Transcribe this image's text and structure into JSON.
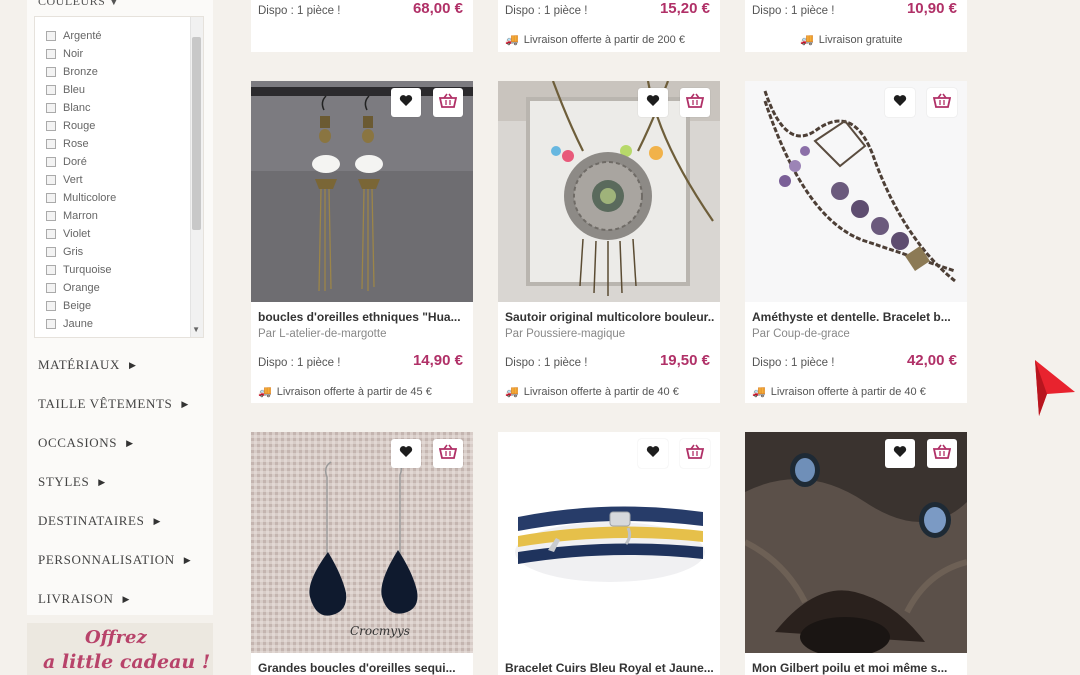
{
  "sidebar": {
    "colors_title": "COULEURS",
    "colors": [
      "Argenté",
      "Noir",
      "Bronze",
      "Bleu",
      "Blanc",
      "Rouge",
      "Rose",
      "Doré",
      "Vert",
      "Multicolore",
      "Marron",
      "Violet",
      "Gris",
      "Turquoise",
      "Orange",
      "Beige",
      "Jaune"
    ],
    "facets": [
      "MATÉRIAUX",
      "TAILLE VÊTEMENTS",
      "OCCASIONS",
      "STYLES",
      "DESTINATAIRES",
      "PERSONNALISATION",
      "LIVRAISON"
    ],
    "promo": {
      "line1": "Offrez",
      "line2": "a little cadeau !"
    }
  },
  "top_row": [
    {
      "stock": "Dispo : 1 pièce !",
      "price": "68,00 €",
      "shipping": ""
    },
    {
      "stock": "Dispo : 1 pièce !",
      "price": "15,20 €",
      "shipping": "Livraison offerte à partir de 200 €"
    },
    {
      "stock": "Dispo : 1 pièce !",
      "price": "10,90 €",
      "shipping": "Livraison gratuite"
    }
  ],
  "products": [
    {
      "title": "boucles d'oreilles ethniques \"Hua...",
      "seller": "Par L-atelier-de-margotte",
      "stock": "Dispo : 1 pièce !",
      "price": "14,90 €",
      "shipping": "Livraison offerte à partir de 45 €"
    },
    {
      "title": "Sautoir original multicolore bouleur...",
      "seller": "Par Poussiere-magique",
      "stock": "Dispo : 1 pièce !",
      "price": "19,50 €",
      "shipping": "Livraison offerte à partir de 40 €"
    },
    {
      "title": "Améthyste et dentelle. Bracelet b...",
      "seller": "Par Coup-de-grace",
      "stock": "Dispo : 1 pièce !",
      "price": "42,00 €",
      "shipping": "Livraison offerte à partir de 40 €"
    },
    {
      "title": "Grandes boucles d'oreilles sequi...",
      "seller": "",
      "stock": "",
      "price": "",
      "shipping": ""
    },
    {
      "title": "Bracelet Cuirs Bleu Royal et Jaune...",
      "seller": "",
      "stock": "",
      "price": "",
      "shipping": ""
    },
    {
      "title": "Mon Gilbert poilu et moi même s...",
      "seller": "",
      "stock": "",
      "price": "",
      "shipping": ""
    }
  ],
  "watermark": "Crocmyys",
  "icons": {
    "favorite": "heart-icon",
    "cart": "basket-icon",
    "shipping": "truck-icon",
    "arrow": "red-arrow-icon"
  },
  "colors": {
    "price": "#b03067",
    "cart_icon": "#b03067",
    "arrow": "#e8232e"
  }
}
